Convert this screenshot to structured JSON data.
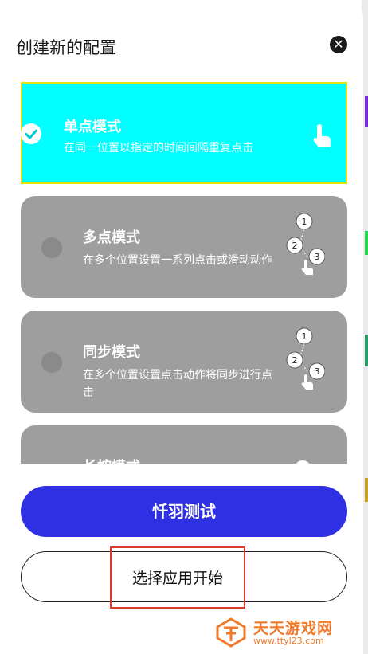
{
  "dialog": {
    "title": "创建新的配置",
    "close_icon": "close-icon"
  },
  "modes": [
    {
      "title": "单点模式",
      "desc": "在同一位置以指定的时间间隔重复点击",
      "selected": true,
      "icon": "tap-hand-icon"
    },
    {
      "title": "多点模式",
      "desc": "在多个位置设置一系列点击或滑动动作",
      "selected": false,
      "icon": "multi-tap-sequence-icon"
    },
    {
      "title": "同步模式",
      "desc": "在多个位置设置点击动作将同步进行点击",
      "selected": false,
      "icon": "multi-tap-sequence-icon"
    },
    {
      "title": "长按模式",
      "desc": "",
      "selected": false,
      "icon": ""
    }
  ],
  "sequence_numbers": [
    "1",
    "2",
    "3"
  ],
  "buttons": {
    "primary": "忏羽测试",
    "secondary": "选择应用开始"
  },
  "watermark": {
    "name": "天天游戏网",
    "url": "www.ttyl23.com"
  },
  "colors": {
    "accent": "#2f2fe4",
    "selected_card": "#00ffff",
    "card": "#9e9e9e",
    "highlight_border": "#e03a2a",
    "watermark": "#f07a2a"
  }
}
